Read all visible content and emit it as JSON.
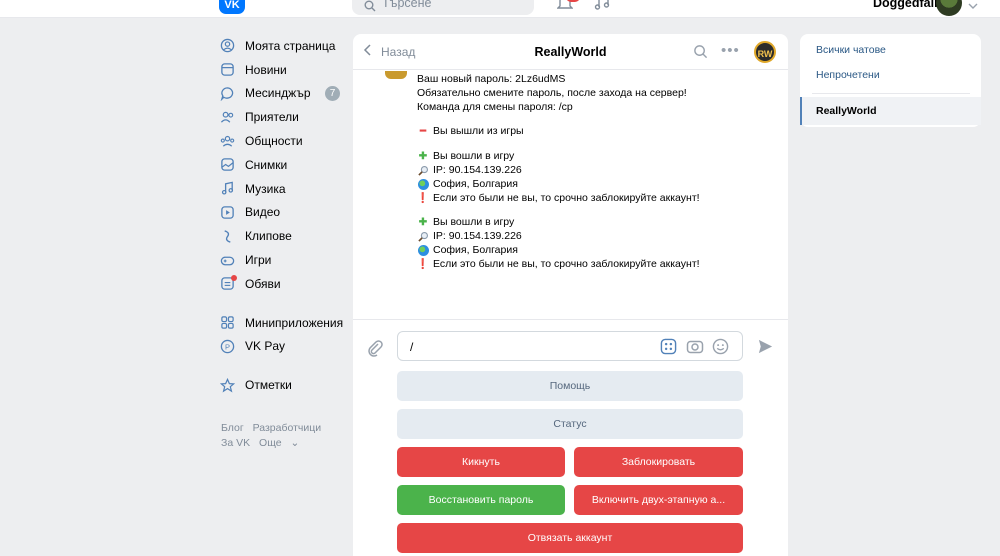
{
  "header": {
    "logo": "VK",
    "search_placeholder": "Търсене",
    "username": "Doggedfair"
  },
  "nav": {
    "items": [
      {
        "label": "Моята страница",
        "icon": "user-circle-icon"
      },
      {
        "label": "Новини",
        "icon": "news-icon"
      },
      {
        "label": "Месинджър",
        "icon": "message-icon",
        "badge": "7"
      },
      {
        "label": "Приятели",
        "icon": "friends-icon"
      },
      {
        "label": "Общности",
        "icon": "communities-icon"
      },
      {
        "label": "Снимки",
        "icon": "photos-icon"
      },
      {
        "label": "Музика",
        "icon": "music-icon"
      },
      {
        "label": "Видео",
        "icon": "video-icon"
      },
      {
        "label": "Клипове",
        "icon": "clips-icon"
      },
      {
        "label": "Игри",
        "icon": "games-icon"
      },
      {
        "label": "Обяви",
        "icon": "ads-icon"
      },
      {
        "label": "Миниприложения",
        "icon": "apps-icon"
      },
      {
        "label": "VK Pay",
        "icon": "vkpay-icon"
      },
      {
        "label": "Отметки",
        "icon": "star-icon"
      }
    ],
    "footer": [
      "Блог",
      "Разработчици",
      "За VK",
      "Още"
    ]
  },
  "chat": {
    "back_label": "Назад",
    "title": "ReallyWorld",
    "lines": [
      {
        "text": "Ваш новый пароль: 2Lz6udMS",
        "emoji": ""
      },
      {
        "text": "Обязательно смените пароль, после захода на сервер!",
        "emoji": ""
      },
      {
        "text": "Команда для смены пароля: /cp",
        "emoji": ""
      },
      {
        "text": "Вы вышли из игры",
        "emoji": "minus"
      },
      {
        "text": "Вы вошли в игру",
        "emoji": "plus"
      },
      {
        "text": "IP: 90.154.139.226",
        "emoji": "magnifier"
      },
      {
        "text": "София, Болгария",
        "emoji": "globe"
      },
      {
        "text": "Если это были не вы, то срочно заблокируйте аккаунт!",
        "emoji": "exclamation"
      },
      {
        "text": "Вы вошли в игру",
        "emoji": "plus"
      },
      {
        "text": "IP: 90.154.139.226",
        "emoji": "magnifier"
      },
      {
        "text": "София, Болгария",
        "emoji": "globe"
      },
      {
        "text": "Если это были не вы, то срочно заблокируйте аккаунт!",
        "emoji": "exclamation"
      }
    ],
    "composer_value": "/",
    "keyboard": {
      "help": "Помощь",
      "status": "Статус",
      "kick": "Кикнуть",
      "block": "Заблокировать",
      "restore": "Восстановить пароль",
      "two_step": "Включить двух-этапную а...",
      "unlink": "Отвязать аккаунт"
    },
    "colors": {
      "red": "#e64646",
      "green": "#4bb34b",
      "gray": "#e5ebf1"
    }
  },
  "right": {
    "all_chats": "Всички чатове",
    "unread": "Непрочетени",
    "active_chat": "ReallyWorld"
  }
}
